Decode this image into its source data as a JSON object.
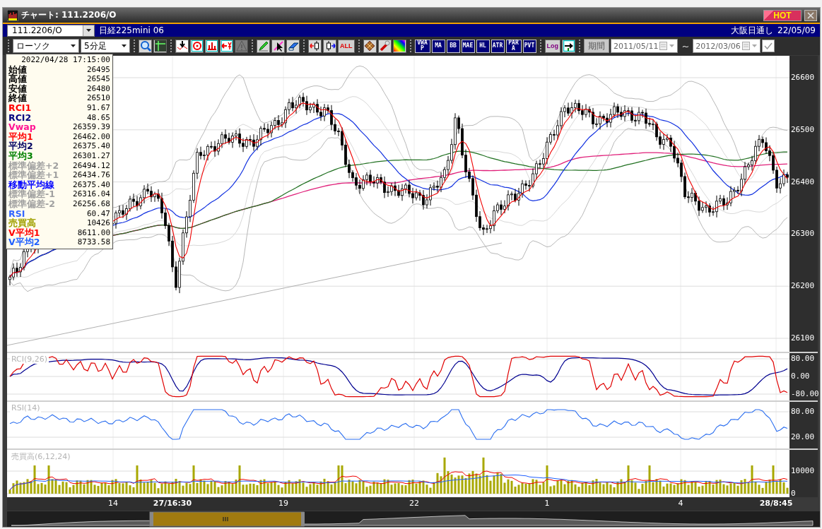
{
  "window": {
    "title": "チャート: 111.2206/O",
    "badge": "HOT"
  },
  "symbol_bar": {
    "symbol": "111.2206/O",
    "name": "日経225mini 06",
    "session": "大阪日通し",
    "date": "22/05/09"
  },
  "toolbar": {
    "chart_type": "ローソク",
    "interval": "5分足",
    "groups": [
      [
        {
          "kind": "icon",
          "disabled": false
        },
        {
          "kind": "icon",
          "disabled": false
        }
      ],
      [
        {
          "kind": "icon",
          "disabled": false
        },
        {
          "kind": "icon",
          "disabled": false
        },
        {
          "kind": "icon",
          "disabled": false
        },
        {
          "kind": "icon",
          "disabled": false
        },
        {
          "kind": "icon",
          "disabled": true
        }
      ],
      [
        {
          "kind": "icon",
          "disabled": false
        },
        {
          "kind": "icon",
          "disabled": false
        },
        {
          "kind": "icon",
          "disabled": false
        }
      ],
      [
        {
          "kind": "icon",
          "disabled": false
        },
        {
          "kind": "icon",
          "disabled": false
        },
        {
          "kind": "light-tag",
          "label": "ALL",
          "color": "#e00000"
        }
      ],
      [
        {
          "kind": "icon",
          "disabled": false
        },
        {
          "kind": "icon",
          "disabled": false
        },
        {
          "kind": "icon",
          "disabled": false
        }
      ],
      [
        {
          "kind": "tag",
          "label": "VWAP"
        },
        {
          "kind": "tag",
          "label": "MA"
        },
        {
          "kind": "tag",
          "label": "BB"
        },
        {
          "kind": "tag",
          "label": "MAE"
        },
        {
          "kind": "tag",
          "label": "HL"
        },
        {
          "kind": "tag",
          "label": "ATR"
        },
        {
          "kind": "tag",
          "label": "PARA"
        },
        {
          "kind": "tag",
          "label": "PVT"
        }
      ],
      [
        {
          "kind": "light-tag",
          "label": "Log",
          "color": "#800080"
        },
        {
          "kind": "icon",
          "disabled": false
        }
      ]
    ],
    "period_button": "期間",
    "start_date": "2011/05/11",
    "separator": "~",
    "end_date": "2012/03/06",
    "apply_checked": true
  },
  "info_panel": {
    "datetime": "2022/04/28  17:15:00",
    "rows": [
      {
        "label": "始値",
        "value": "26495",
        "color": "#000000"
      },
      {
        "label": "高値",
        "value": "26545",
        "color": "#000000"
      },
      {
        "label": "安値",
        "value": "26480",
        "color": "#000000"
      },
      {
        "label": "終値",
        "value": "26510",
        "color": "#000000"
      },
      {
        "label": "RCI1",
        "value": "91.67",
        "color": "#ff0000"
      },
      {
        "label": "RCI2",
        "value": "48.65",
        "color": "#000080"
      },
      {
        "label": "Vwap",
        "value": "26359.39",
        "color": "#ff1493"
      },
      {
        "label": "平均1",
        "value": "26462.00",
        "color": "#ff0000"
      },
      {
        "label": "平均2",
        "value": "26375.40",
        "color": "#000060"
      },
      {
        "label": "平均3",
        "value": "26301.27",
        "color": "#008000"
      },
      {
        "label": "標準偏差+2",
        "value": "26494.12",
        "color": "#a0a0a0"
      },
      {
        "label": "標準偏差+1",
        "value": "26434.76",
        "color": "#a0a0a0"
      },
      {
        "label": "移動平均線",
        "value": "26375.40",
        "color": "#0000ff"
      },
      {
        "label": "標準偏差-1",
        "value": "26316.04",
        "color": "#a0a0a0"
      },
      {
        "label": "標準偏差-2",
        "value": "26256.68",
        "color": "#a0a0a0"
      },
      {
        "label": "RSI",
        "value": "60.47",
        "color": "#3366ff"
      },
      {
        "label": "売買高",
        "value": "10426",
        "color": "#a0a000"
      },
      {
        "label": "V平均1",
        "value": "8611.00",
        "color": "#ff0000"
      },
      {
        "label": "V平均2",
        "value": "8733.58",
        "color": "#2060ff"
      }
    ]
  },
  "price_panel": {
    "axis": [
      "26600",
      "26500",
      "26400",
      "26300",
      "26200",
      "26100"
    ]
  },
  "rci_panel": {
    "title": "RCI(9,26)",
    "axis": [
      "80.00",
      "0.00",
      "-80.00"
    ]
  },
  "rsi_panel": {
    "title": "RSI(14)",
    "axis": [
      "80.00",
      "20.00"
    ]
  },
  "volume_panel": {
    "title": "売買高(6,12,24)",
    "axis": [
      "10000",
      "0"
    ]
  },
  "time_axis": [
    {
      "label": "14",
      "emphasized": false
    },
    {
      "label": "27/16:30",
      "emphasized": true
    },
    {
      "label": "19",
      "emphasized": false
    },
    {
      "label": "22",
      "emphasized": false
    },
    {
      "label": "1",
      "emphasized": false
    },
    {
      "label": "4",
      "emphasized": false
    },
    {
      "label": "28/8:45",
      "emphasized": true
    }
  ]
}
